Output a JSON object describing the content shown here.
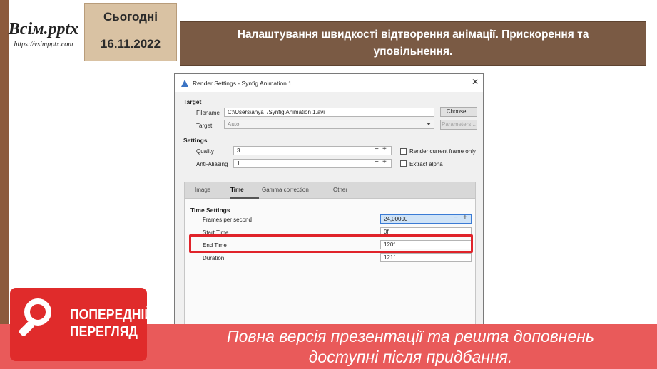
{
  "header": {
    "logo_text": "Всім.pptx",
    "logo_url": "https://vsimpptx.com",
    "date_label": "Сьогодні",
    "date_value": "16.11.2022",
    "slide_title": "Налаштування швидкості відтворення анімації.  Прискорення та уповільнення."
  },
  "dialog": {
    "title": "Render Settings - Synfig Animation 1",
    "close_icon": "close-icon",
    "target_section": "Target",
    "filename_label": "Filename",
    "filename_value": "C:\\Users\\anya_/Synfig Animation 1.avi",
    "choose_button": "Choose...",
    "target_label": "Target",
    "target_value": "Auto",
    "parameters_button": "Parameters...",
    "settings_section": "Settings",
    "quality_label": "Quality",
    "quality_value": "3",
    "antialias_label": "Anti-Aliasing",
    "antialias_value": "1",
    "render_current_label": "Render current frame only",
    "extract_alpha_label": "Extract alpha",
    "tabs": [
      "Image",
      "Time",
      "Gamma correction",
      "Other"
    ],
    "active_tab": "Time",
    "time_section": "Time Settings",
    "fps_label": "Frames per second",
    "fps_value": "24,00000",
    "start_label": "Start Time",
    "start_value": "0f",
    "end_label": "End Time",
    "end_value": "120f",
    "duration_label": "Duration",
    "duration_value": "121f"
  },
  "preview_badge": {
    "line1": "ПОПЕРЕДНІЙ",
    "line2": "ПЕРЕГЛЯД",
    "icon": "magnifier-icon"
  },
  "footer": {
    "line1": "Повна версія презентації та решта доповнень",
    "line2": "доступні після придбання."
  },
  "colors": {
    "brown_bar": "#7a5a44",
    "date_box": "#d9c2a3",
    "footer_red": "#e95a5a",
    "badge_red": "#e02b2b",
    "highlight_red": "#e0232a"
  }
}
